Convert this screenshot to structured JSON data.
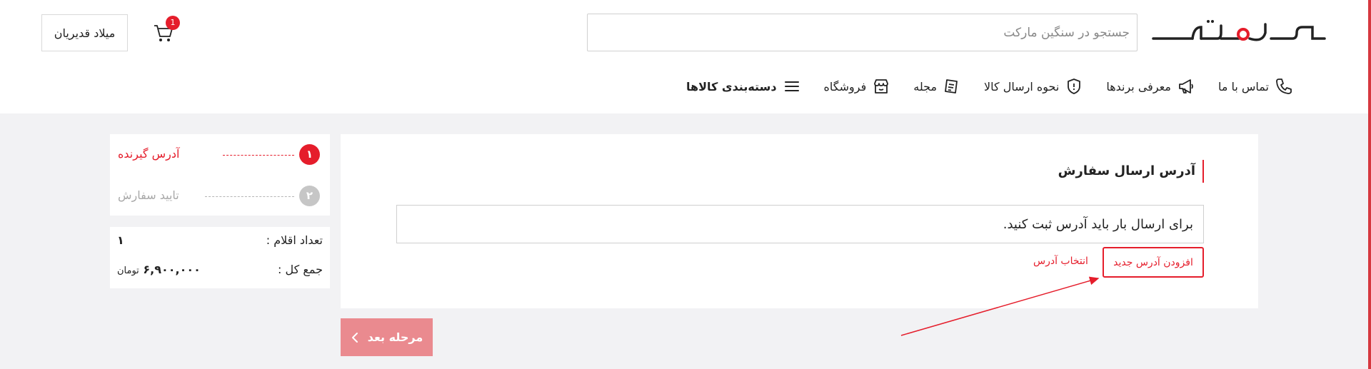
{
  "header": {
    "logo_text": "سنگین‌مارکت",
    "search": {
      "placeholder": "جستجو در سنگین مارکت"
    },
    "cart": {
      "count": "1"
    },
    "user": {
      "name": "میلاد قدیریان"
    }
  },
  "nav": {
    "items": [
      {
        "label": "دسته‌بندی کالاها",
        "icon": "menu-icon"
      },
      {
        "label": "فروشگاه",
        "icon": "shop-icon"
      },
      {
        "label": "مجله",
        "icon": "magazine-icon"
      },
      {
        "label": "نحوه ارسال کالا",
        "icon": "shield-icon"
      },
      {
        "label": "معرفی برندها",
        "icon": "megaphone-icon"
      },
      {
        "label": "تماس با ما",
        "icon": "phone-icon"
      }
    ]
  },
  "steps": [
    {
      "number": "۱",
      "label": "آدرس گیرنده",
      "active": true
    },
    {
      "number": "۲",
      "label": "تایید سفارش",
      "active": false
    }
  ],
  "summary": {
    "items_label": "تعداد اقلام :",
    "items_value": "۱",
    "total_label": "جمع کل :",
    "total_value": "۶,۹۰۰,۰۰۰",
    "currency": "تومان"
  },
  "main": {
    "title": "آدرس ارسال سفارش",
    "message": "برای ارسال بار باید آدرس ثبت کنید.",
    "add_button": "افزودن آدرس جدید",
    "select_link": "انتخاب آدرس"
  },
  "next_button": {
    "label": "مرحله بعد"
  },
  "colors": {
    "accent": "#e51d2b",
    "disabled_button": "#ea8a8f",
    "background": "#f2f2f4"
  }
}
